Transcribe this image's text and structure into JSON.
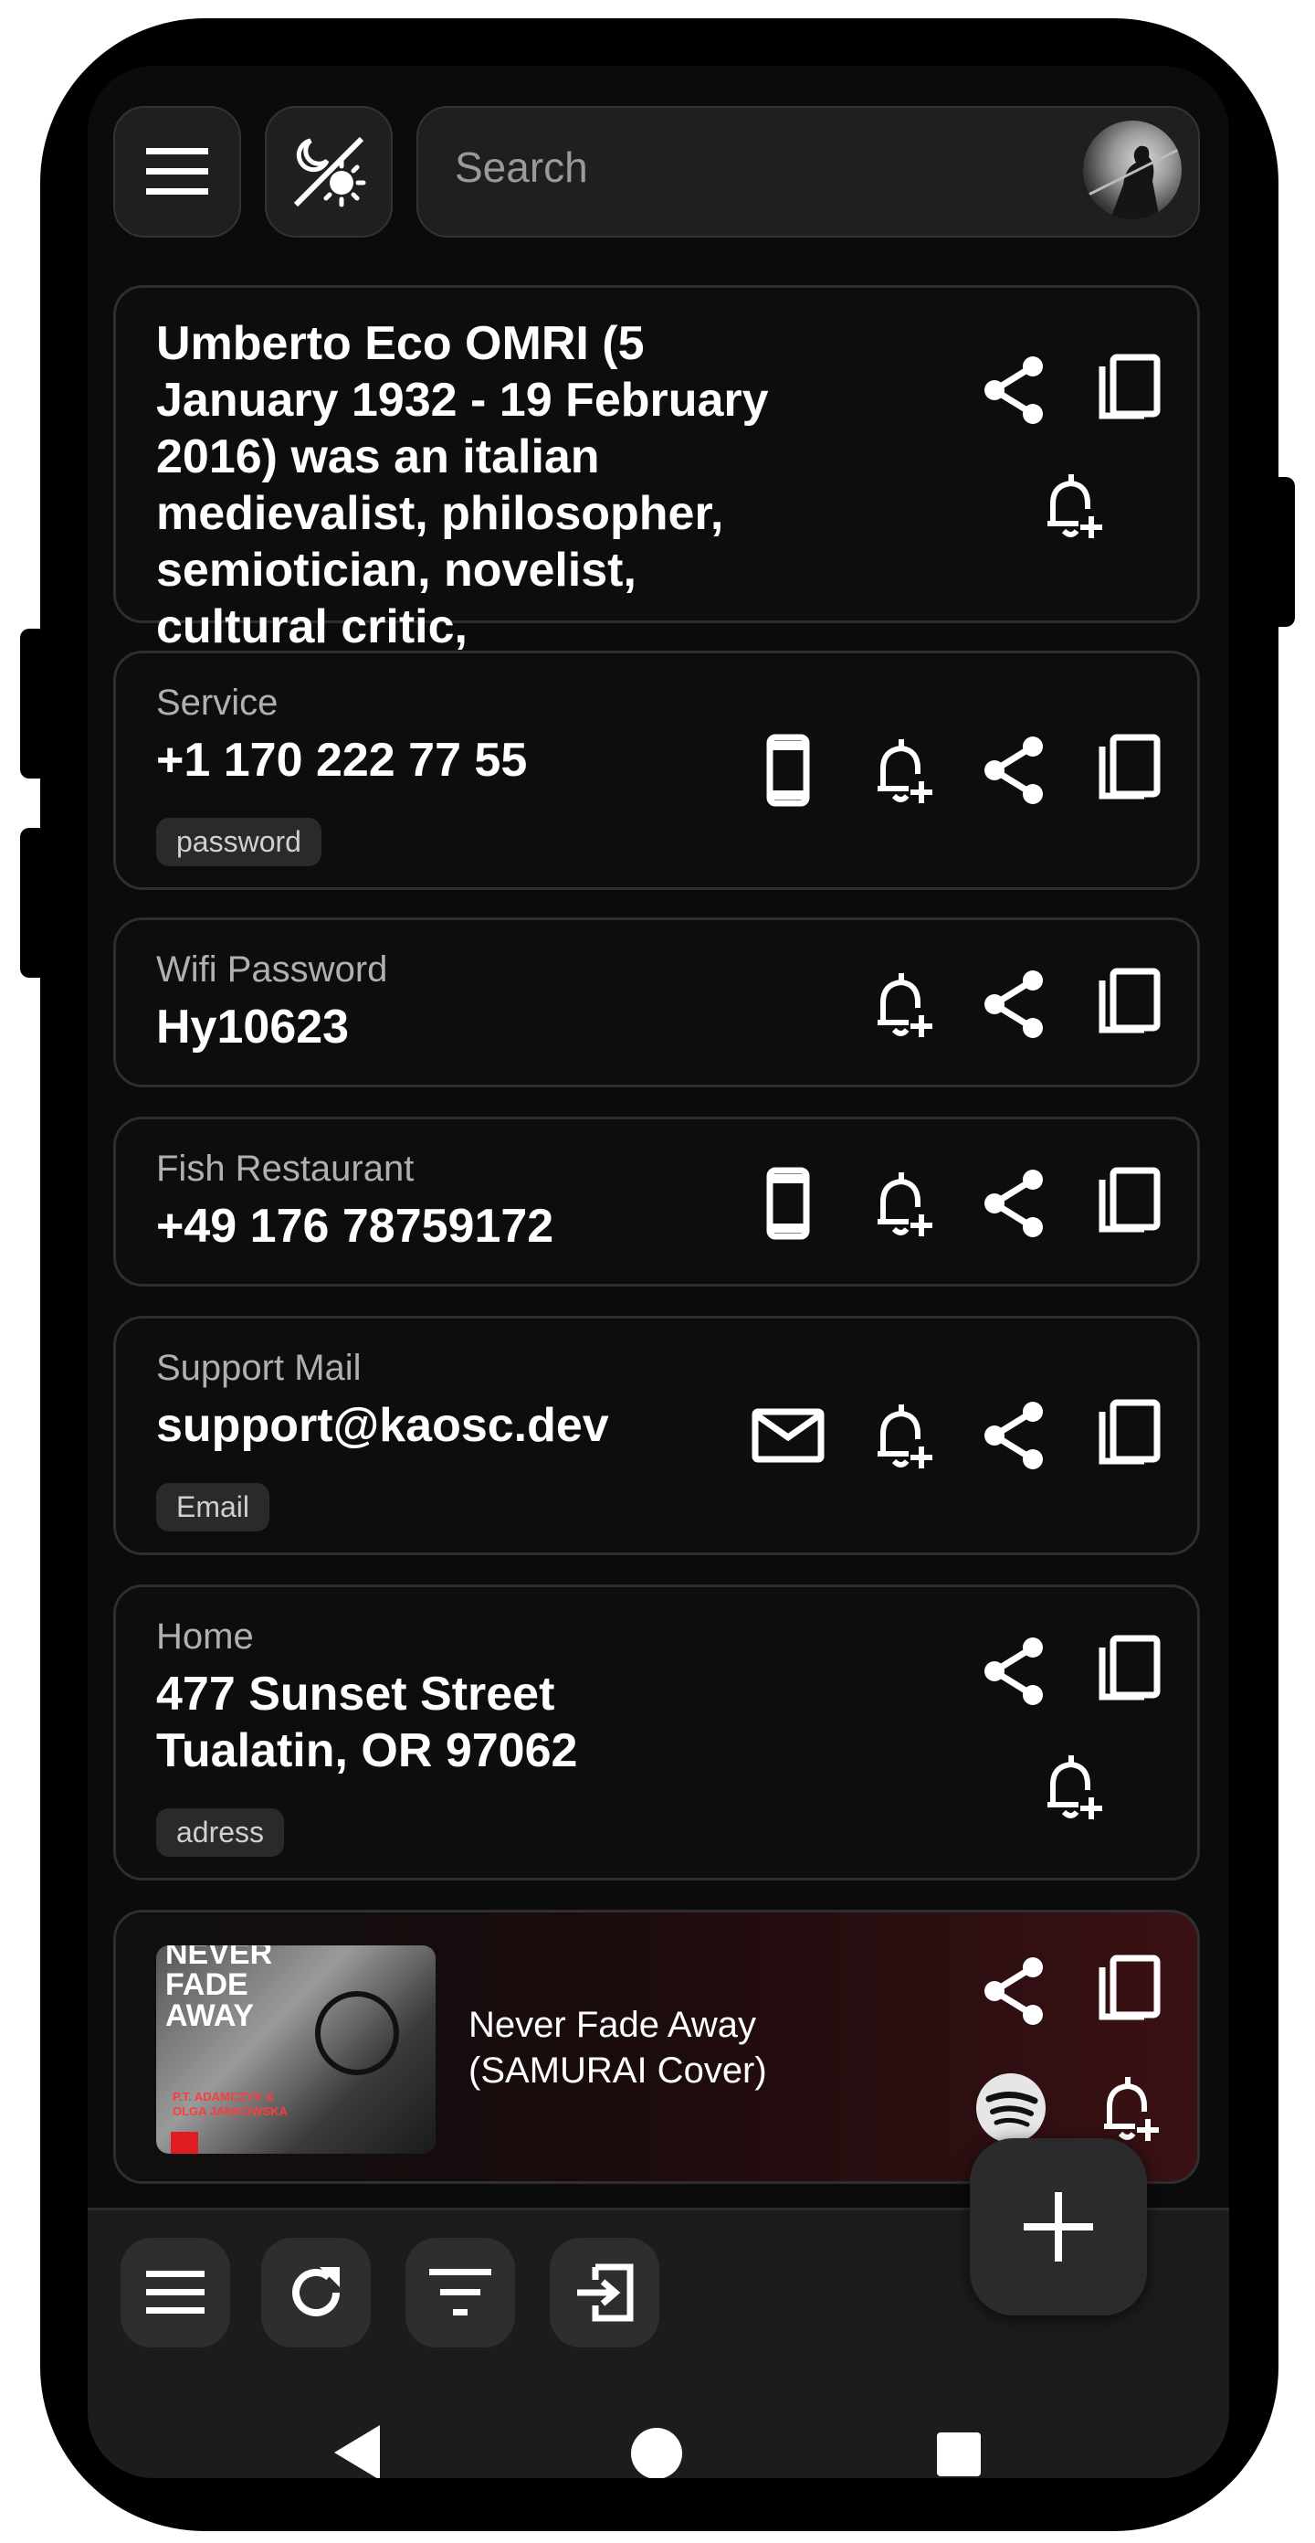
{
  "topbar": {
    "search_placeholder": "Search"
  },
  "cards": [
    {
      "label": "",
      "value": "Umberto Eco OMRI (5 January 1932 - 19 February 2016) was an italian medievalist, philosopher, semiotician, novelist, cultural critic,",
      "chip": ""
    },
    {
      "label": "Service",
      "value": "+1 170 222 77 55",
      "chip": "password"
    },
    {
      "label": "Wifi Password",
      "value": "Hy10623",
      "chip": ""
    },
    {
      "label": "Fish Restaurant",
      "value": "+49 176 78759172",
      "chip": ""
    },
    {
      "label": "Support Mail",
      "value": "support@kaosc.dev",
      "chip": "Email"
    },
    {
      "label": "Home",
      "value": "477 Sunset Street Tualatin, OR 97062",
      "chip": "adress"
    },
    {
      "label": "",
      "value": "Never Fade Away (SAMURAI Cover)",
      "chip": ""
    }
  ],
  "album_art": {
    "title_text": "NEVER FADE AWAY",
    "artist_text": "P.T. ADAMCZYK & OLGA JANKOWSKA"
  },
  "colors": {
    "background": "#0b0b0b",
    "card_border": "#2e2e2e",
    "music_card": "#3a1114",
    "spotify_icon": "#e6e6e6"
  },
  "icons": [
    "menu-icon",
    "theme-toggle-icon",
    "share-icon",
    "copy-icon",
    "bell-plus-icon",
    "phone-icon",
    "mail-icon",
    "spotify-icon",
    "refresh-icon",
    "filter-icon",
    "login-icon",
    "plus-icon",
    "back-icon",
    "home-icon",
    "recents-icon"
  ]
}
